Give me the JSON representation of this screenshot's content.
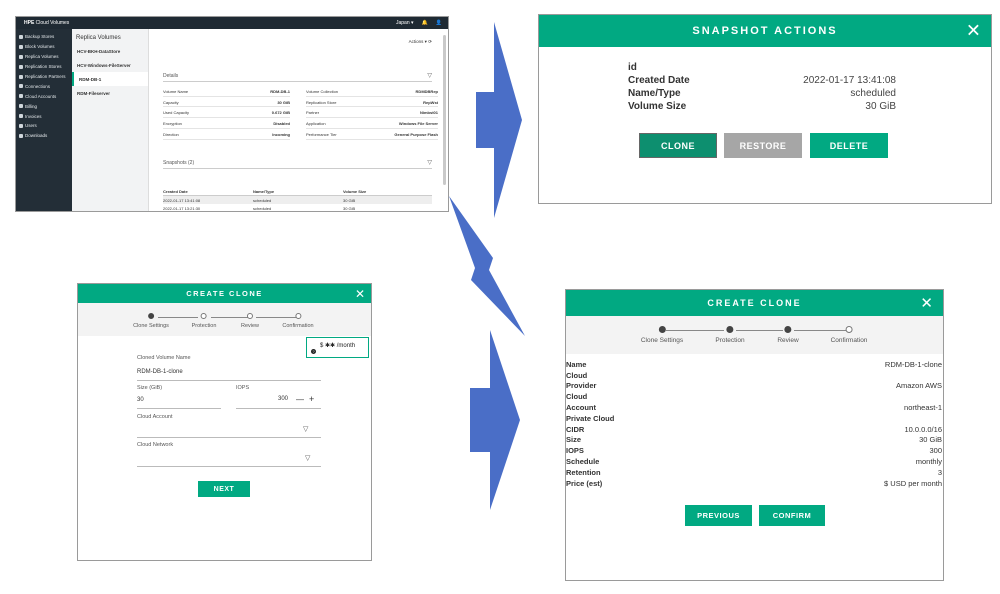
{
  "console": {
    "logo_bold": "HPE",
    "logo_rest": "Cloud Volumes",
    "region": "Japan",
    "region_caret": "▾",
    "bell_icon": "🔔",
    "user_icon": "👤",
    "sidebar": [
      "Backup Stores",
      "Block Volumes",
      "Replica Volumes",
      "Replication Stores",
      "Replication Partners",
      "Connections",
      "Cloud Accounts",
      "Billing",
      "Invoices",
      "Users",
      "Downloads"
    ],
    "list_header": "Replica Volumes",
    "volumes": [
      "HCV-BKH-DataStore",
      "HCV-Windows-FileServer",
      "RDM-DB-1",
      "RDM-Fileserver"
    ],
    "selected_index": 2,
    "actions_label": "Actions ▾",
    "refresh_icon": "⟳",
    "details_label": "Details",
    "details_left": [
      {
        "k": "Volume Name",
        "v": "RDM-DB-1"
      },
      {
        "k": "Capacity",
        "v": "30 GiB"
      },
      {
        "k": "Used Capacity",
        "v": "0.672 GiB"
      },
      {
        "k": "Encryption",
        "v": "Disabled"
      },
      {
        "k": "Direction",
        "v": "Incoming"
      }
    ],
    "details_right": [
      {
        "k": "Volume Collection",
        "v": "RDMDBRep"
      },
      {
        "k": "Replication Store",
        "v": "RepWst"
      },
      {
        "k": "Partner",
        "v": "Nimbst01"
      },
      {
        "k": "Application",
        "v": "Windows File Server"
      },
      {
        "k": "Performance Tier",
        "v": "General Purpose Flash"
      }
    ],
    "snapshots_label": "Snapshots (2)",
    "table_headers": [
      "Created Date",
      "Name/Type",
      "Volume Size"
    ],
    "table_rows": [
      [
        "2022-01-17 13:41:08",
        "scheduled",
        "30 GiB"
      ],
      [
        "2022-01-17 13:21:30",
        "scheduled",
        "30 GiB"
      ]
    ],
    "chevron": "▽"
  },
  "snapshot_actions": {
    "title": "SNAPSHOT ACTIONS",
    "close": "✕",
    "rows": [
      {
        "k": "id",
        "v": ""
      },
      {
        "k": "Created Date",
        "v": "2022-01-17 13:41:08"
      },
      {
        "k": "Name/Type",
        "v": "scheduled"
      },
      {
        "k": "Volume Size",
        "v": "30 GiB"
      }
    ],
    "buttons": {
      "clone": "CLONE",
      "restore": "RESTORE",
      "delete": "DELETE"
    }
  },
  "create_clone_form": {
    "title": "CREATE CLONE",
    "close": "✕",
    "steps": [
      "Clone Settings",
      "Protection",
      "Review",
      "Confirmation"
    ],
    "price": "$ ✱✱ /month",
    "help_icon": "?",
    "cloned_name_label": "Cloned Volume Name",
    "cloned_name_value": "RDM-DB-1-clone",
    "size_label": "Size (GiB)",
    "size_value": "30",
    "iops_label": "IOPS",
    "iops_value": "300",
    "minus": "—",
    "plus": "+",
    "cloud_account_label": "Cloud Account",
    "cloud_network_label": "Cloud Network",
    "chevron": "▽",
    "next": "NEXT"
  },
  "confirm_clone": {
    "title": "CREATE CLONE",
    "close": "✕",
    "steps": [
      "Clone Settings",
      "Protection",
      "Review",
      "Confirmation"
    ],
    "rows": [
      {
        "k": "Name",
        "v": "RDM-DB-1-clone"
      },
      {
        "k": "Cloud",
        "v": ""
      },
      {
        "k": "Provider",
        "v": "Amazon AWS"
      },
      {
        "k": "Cloud",
        "v": ""
      },
      {
        "k": "Account",
        "v": "northeast-1"
      },
      {
        "k": "Private Cloud",
        "v": ""
      },
      {
        "k": "CIDR",
        "v": "10.0.0.0/16"
      },
      {
        "k": "Size",
        "v": "30 GiB"
      },
      {
        "k": "IOPS",
        "v": "300"
      },
      {
        "k": "Schedule",
        "v": "monthly"
      },
      {
        "k": "Retention",
        "v": "3"
      },
      {
        "k": "Price (est)",
        "v": "$        USD per month"
      }
    ],
    "previous": "PREVIOUS",
    "confirm": "CONFIRM"
  },
  "colors": {
    "accent": "#01a982",
    "sidebar_bg": "#232e37",
    "arrow": "#4a6ec7"
  }
}
